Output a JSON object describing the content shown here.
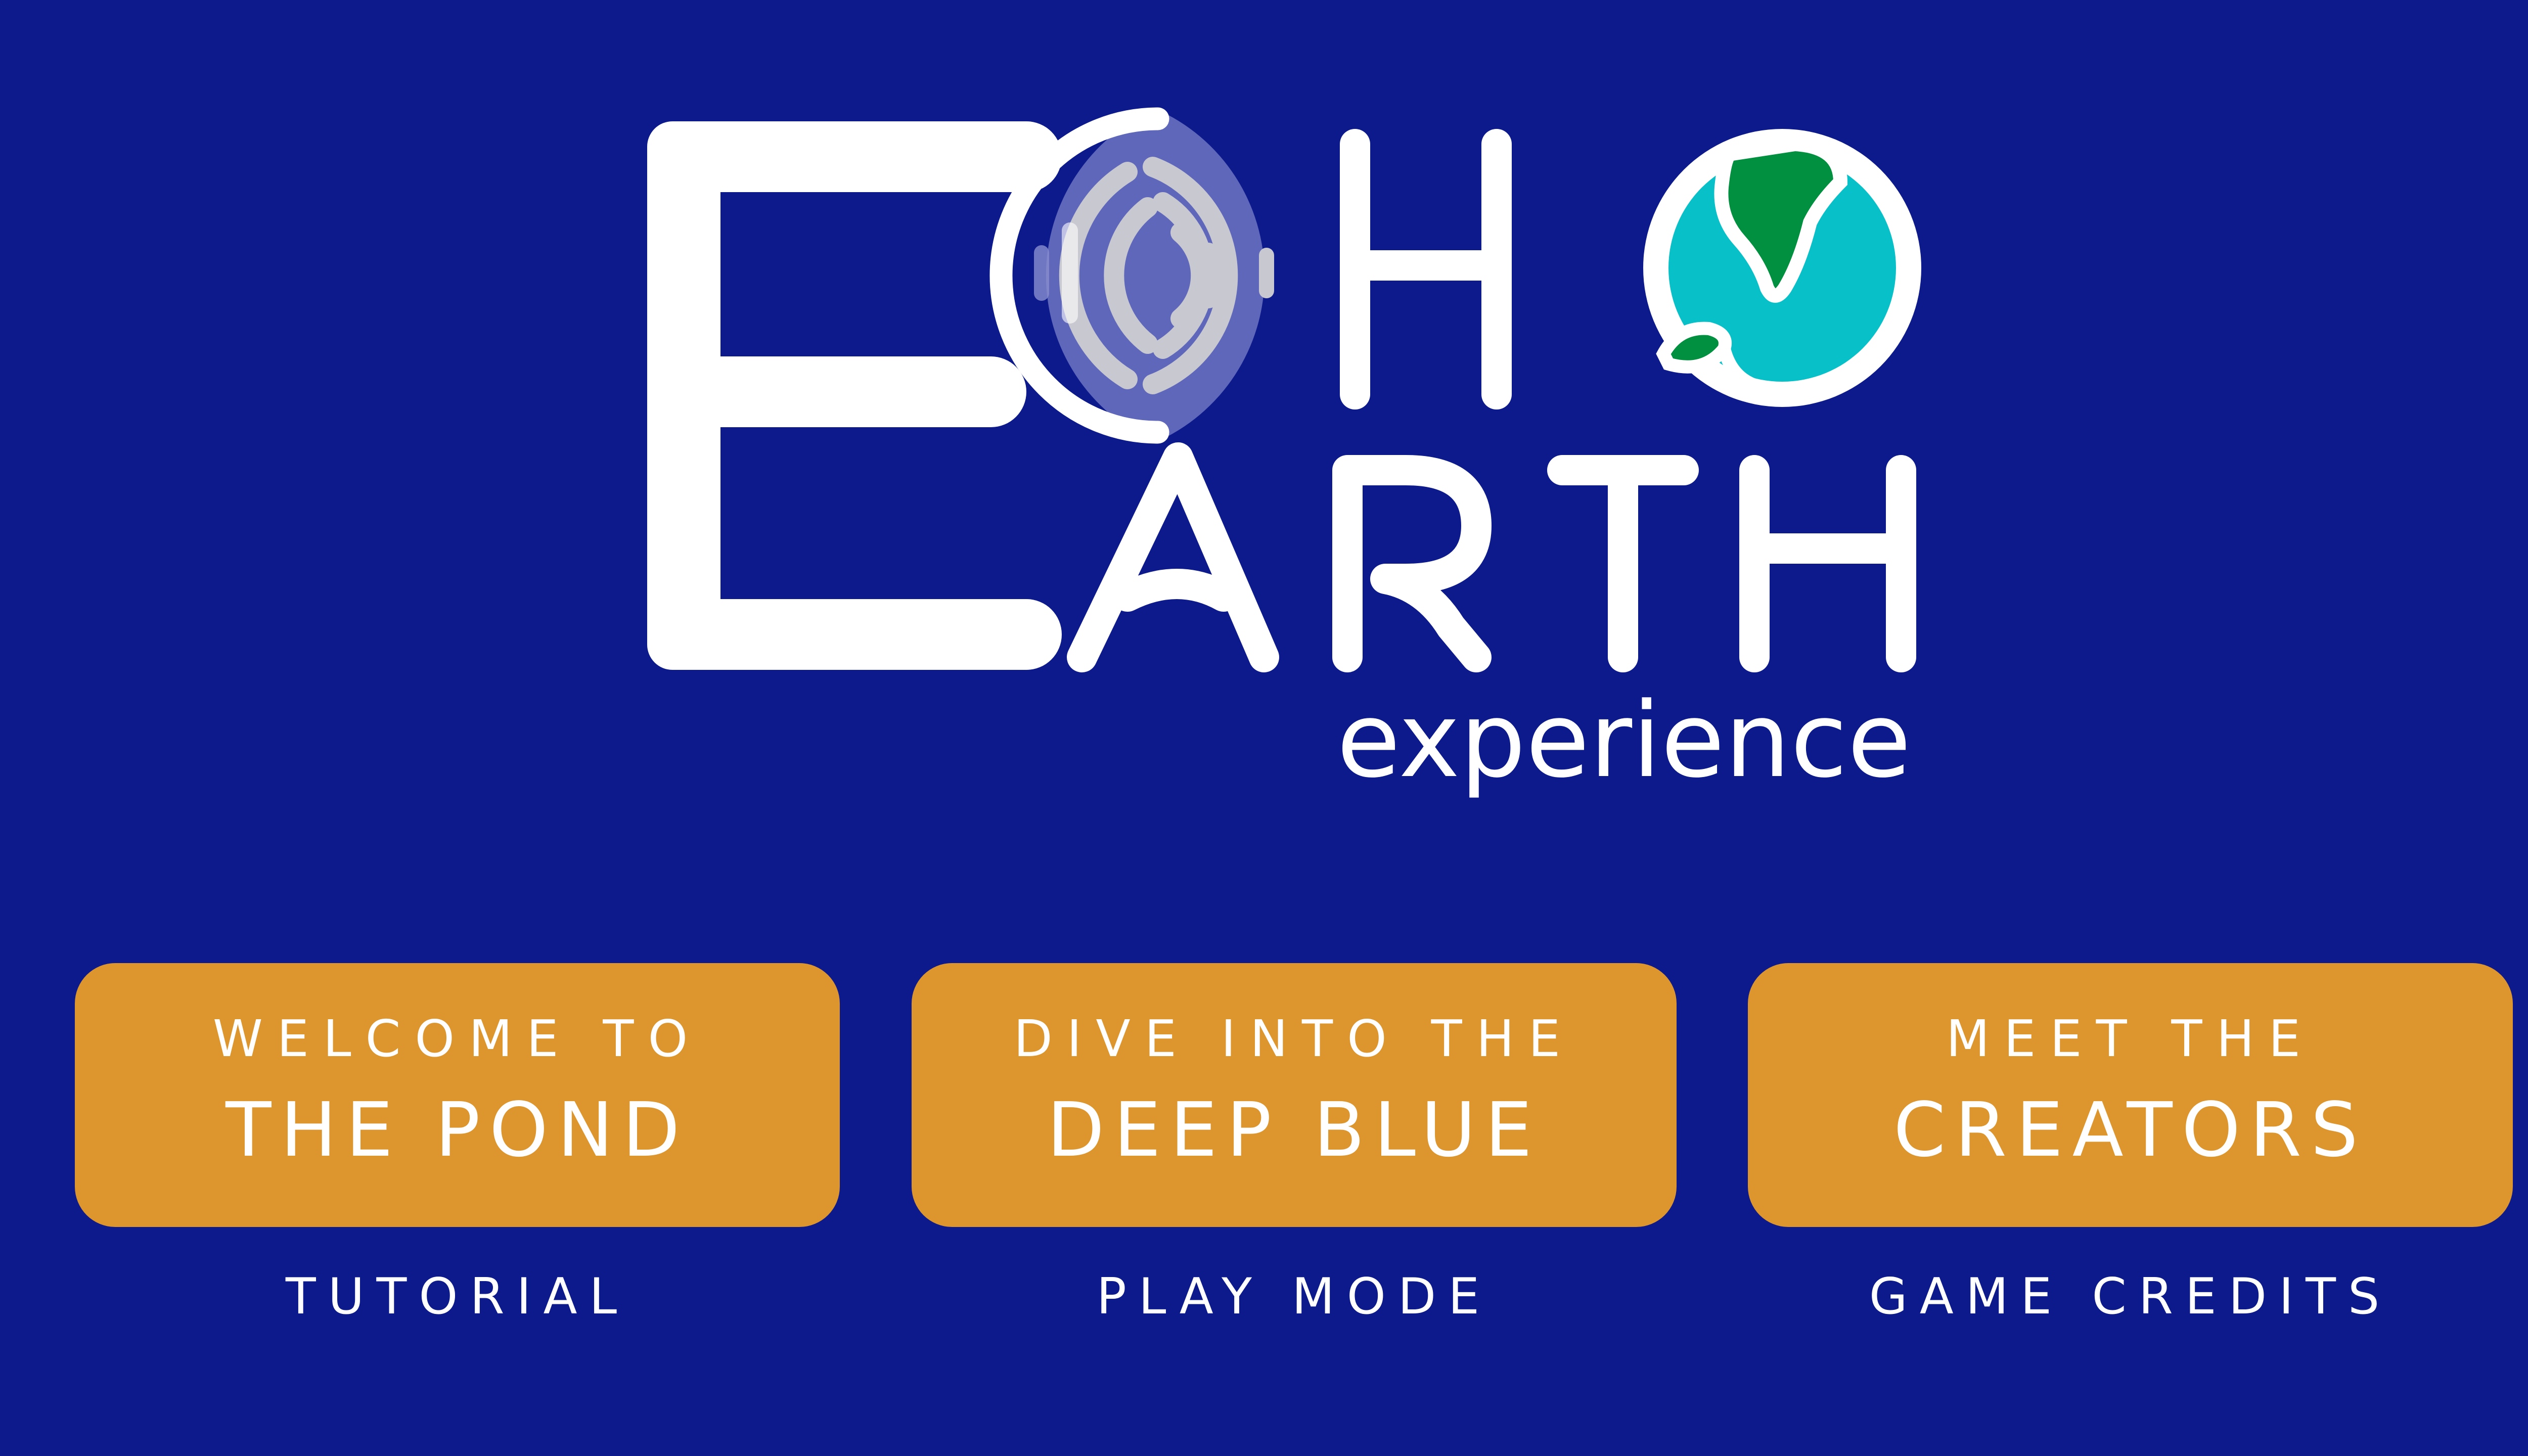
{
  "logo": {
    "line1": "ECHO",
    "line2": "EARTH",
    "subtitle": "experience",
    "icons": [
      "sonar-wave-icon",
      "globe-icon"
    ],
    "colors": {
      "background": "#0d1a8b",
      "letters": "#ffffff",
      "ocean": "#08c0c8",
      "land": "#009040",
      "sonar": "#c8c8d0"
    }
  },
  "menu": {
    "tutorial": {
      "line1": "WELCOME TO",
      "line2": "THE POND",
      "caption": "TUTORIAL"
    },
    "play": {
      "line1": "DIVE INTO THE",
      "line2": "DEEP BLUE",
      "caption": "PLAY MODE"
    },
    "credits": {
      "line1": "MEET THE",
      "line2": "CREATORS",
      "caption": "GAME CREDITS"
    },
    "button_color": "#dd952e"
  }
}
